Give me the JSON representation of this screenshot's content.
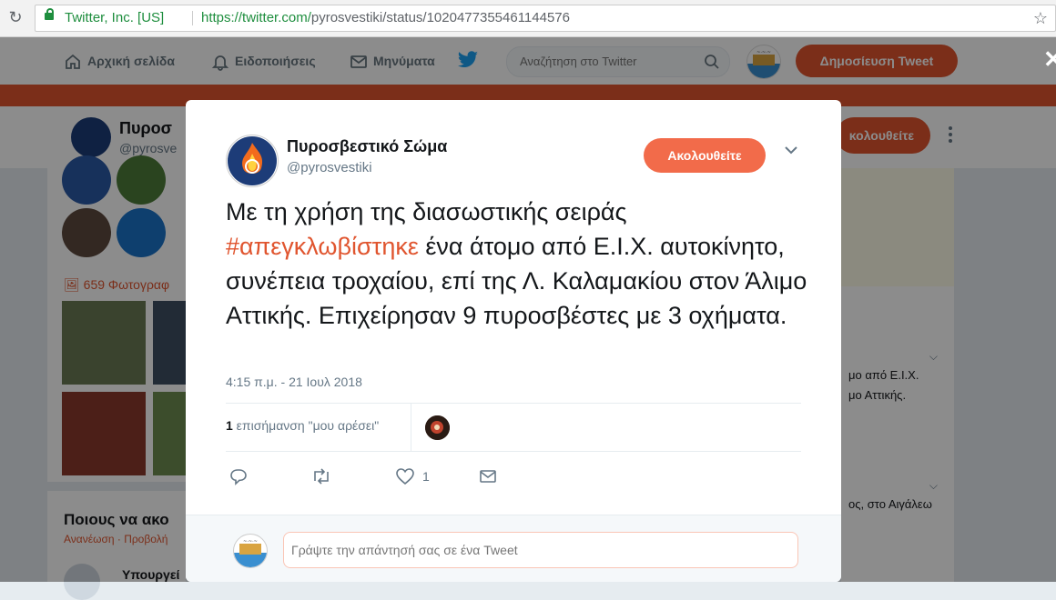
{
  "browser": {
    "secure_label": "Twitter, Inc. [US]",
    "url_base": "https://twitter.com/",
    "url_path": "pyrosvestiki/status/1020477355461144576"
  },
  "nav": {
    "home": "Αρχική σελίδα",
    "notifications": "Ειδοποιήσεις",
    "messages": "Μηνύματα",
    "search_placeholder": "Αναζήτηση στο Twitter",
    "tweet_button": "Δημοσίευση Tweet"
  },
  "profile": {
    "name": "Πυροσ",
    "handle": "@pyrosve",
    "follow_label": "κολουθείτε",
    "photos_count": "659 Φωτογραφ",
    "who_to_follow": "Ποιους να ακο",
    "who_links": "Ανανέωση · Προβολή",
    "who_name": "Υπουργεί"
  },
  "right_column": {
    "line1": "μο από Ε.Ι.Χ.",
    "line2": "μο Αττικής.",
    "line3": "ος, στο Αιγάλεω"
  },
  "tweet": {
    "author_name": "Πυροσβεστικό Σώμα",
    "author_handle": "@pyrosvestiki",
    "follow_button": "Ακολουθείτε",
    "text_before": "Με τη χρήση της διασωστικής σειράς ",
    "hashtag": "#απεγκλωβίστηκε",
    "text_after": " ένα άτομο από Ε.Ι.Χ. αυτοκίνητο, συνέπεια τροχαίου, επί της Λ. Καλαμακίου στον Άλιμο Αττικής. Επιχείρησαν 9 πυροσβέστες με 3 οχήματα.",
    "timestamp": "4:15 π.μ. - 21 Ιουλ 2018",
    "likes_count": "1",
    "likes_label": " επισήμανση \"μου αρέσει\"",
    "like_action_count": "1",
    "reply_placeholder": "Γράψτε την απάντησή σας σε ένα Tweet"
  },
  "colors": {
    "brand": "#e0552f",
    "follow_button": "#f26b4a",
    "secure_green": "#1e8e3e"
  }
}
